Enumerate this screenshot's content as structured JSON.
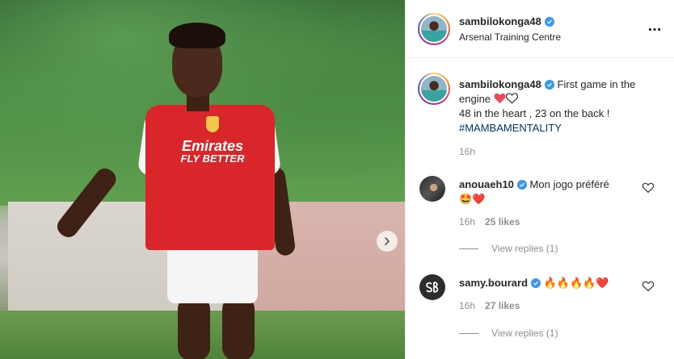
{
  "post": {
    "author": "sambilokonga48",
    "location": "Arsenal Training Centre",
    "more_icon": "ellipsis-icon",
    "photo": {
      "sponsor_line1": "Emirates",
      "sponsor_line2": "FLY BETTER",
      "next_icon": "chevron-right-icon"
    }
  },
  "caption": {
    "author": "sambilokonga48",
    "line1": "First game in the engine",
    "line2": "48 in the heart , 23 on the back !",
    "hashtag": "#MAMBAMENTALITY",
    "time": "16h"
  },
  "comments": [
    {
      "author": "anouaeh10",
      "text": "Mon jogo préféré",
      "emojis": "🤩❤️",
      "time": "16h",
      "likes": "25 likes",
      "replies": "View replies (1)"
    },
    {
      "author": "samy.bourard",
      "text": "",
      "emojis": "🔥🔥🔥🔥❤️",
      "time": "16h",
      "likes": "27 likes",
      "replies": "View replies (1)"
    }
  ],
  "colors": {
    "verified": "#3897f0",
    "heart_red": "#ed4956",
    "hashtag": "#00376b",
    "muted": "#8e8e8e"
  }
}
